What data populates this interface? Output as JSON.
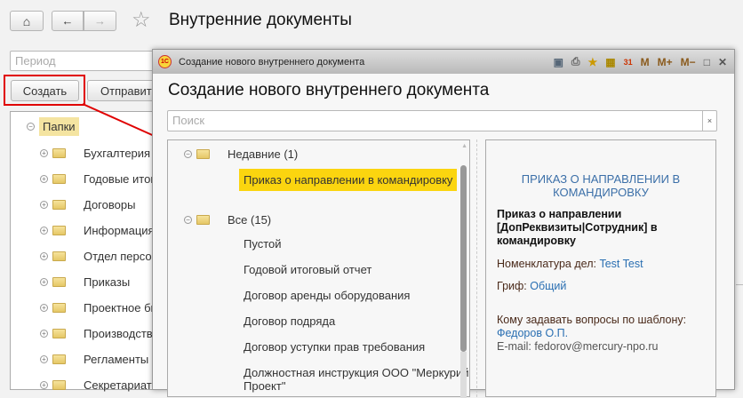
{
  "page": {
    "title": "Внутренние документы",
    "period_placeholder": "Период",
    "create_label": "Создать",
    "send_label": "Отправить"
  },
  "tree": {
    "root": "Папки",
    "items": [
      "Бухгалтерия",
      "Годовые итоги",
      "Договоры",
      "Информация",
      "Отдел персонала",
      "Приказы",
      "Проектное бюро",
      "Производство",
      "Регламенты",
      "Секретариат"
    ]
  },
  "modal": {
    "window_title": "Создание нового внутреннего документа",
    "heading": "Создание нового внутреннего документа",
    "search_placeholder": "Поиск",
    "toolbar": {
      "m": "M",
      "mplus": "M+",
      "mminus": "M−"
    },
    "groups": {
      "recent": "Недавние (1)",
      "all": "Все (15)"
    },
    "recent_items": [
      "Приказ о направлении в командировку"
    ],
    "all_items": [
      "Пустой",
      "Годовой итоговый отчет",
      "Договор аренды оборудования",
      "Договор подряда",
      "Договор уступки прав требования",
      "Должностная инструкция ООО \"Меркурий Проект\""
    ],
    "preview": {
      "title": "ПРИКАЗ О НАПРАВЛЕНИИ В КОМАНДИРОВКУ",
      "name": "Приказ о направлении [ДопРеквизиты|Сотрудник] в командировку",
      "nomenclature_label": "Номенклатура дел:",
      "nomenclature_value": "Test Test",
      "grif_label": "Гриф:",
      "grif_value": "Общий",
      "contact_label": "Кому задавать вопросы по шаблону:",
      "contact_name": "Федоров О.П.",
      "email": "E-mail: fedorov@mercury-npo.ru"
    }
  },
  "colors": {
    "highlight": "#fbd50f",
    "accent": "#2a6fb2",
    "annotation": "#e00000"
  }
}
